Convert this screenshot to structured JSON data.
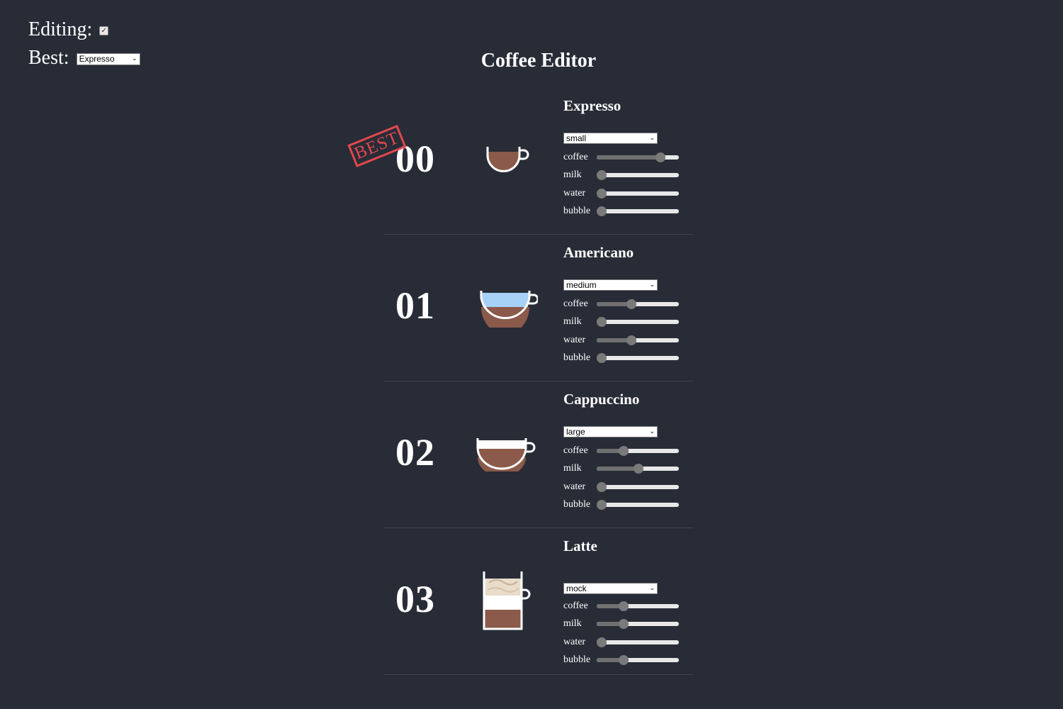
{
  "controls": {
    "editing_label": "Editing:",
    "editing_checked": true,
    "best_label": "Best:",
    "best_value": "Expresso"
  },
  "title": "Coffee Editor",
  "stamp_text": "BEST",
  "ingredient_labels": [
    "coffee",
    "milk",
    "water",
    "bubble"
  ],
  "coffees": [
    {
      "number": "00",
      "name": "Expresso",
      "size": "small",
      "best": true,
      "levels": {
        "coffee": 0.8,
        "milk": 0.0,
        "water": 0.0,
        "bubble": 0.0
      }
    },
    {
      "number": "01",
      "name": "Americano",
      "size": "medium",
      "best": false,
      "levels": {
        "coffee": 0.4,
        "milk": 0.0,
        "water": 0.4,
        "bubble": 0.0
      }
    },
    {
      "number": "02",
      "name": "Cappuccino",
      "size": "large",
      "best": false,
      "levels": {
        "coffee": 0.3,
        "milk": 0.5,
        "water": 0.0,
        "bubble": 0.0
      }
    },
    {
      "number": "03",
      "name": "Latte",
      "size": "mock",
      "best": false,
      "levels": {
        "coffee": 0.3,
        "milk": 0.3,
        "water": 0.0,
        "bubble": 0.3
      }
    }
  ],
  "colors": {
    "background": "#282c37",
    "coffee": "#8b5a4a",
    "water": "#a6d2f7",
    "milk": "#ffffff",
    "foam": "#e9dccb",
    "stamp": "#e2484d"
  }
}
